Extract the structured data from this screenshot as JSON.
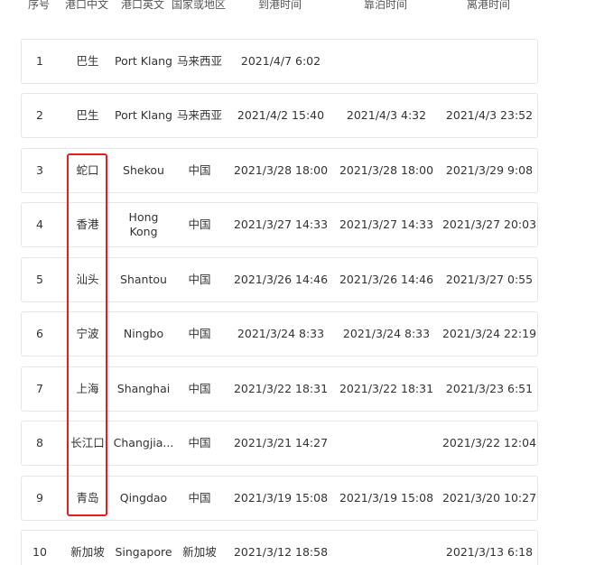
{
  "table": {
    "headers": [
      "序号",
      "港口中文",
      "港口英文",
      "国家或地区",
      "到港时间",
      "靠泊时间",
      "离港时间"
    ],
    "rows": [
      {
        "idx": "1",
        "port_cn": "巴生",
        "port_en": "Port Klang",
        "country": "马来西亚",
        "arrival": "2021/4/7 6:02",
        "berth": "",
        "departure": ""
      },
      {
        "idx": "2",
        "port_cn": "巴生",
        "port_en": "Port Klang",
        "country": "马来西亚",
        "arrival": "2021/4/2 15:40",
        "berth": "2021/4/3 4:32",
        "departure": "2021/4/3 23:52"
      },
      {
        "idx": "3",
        "port_cn": "蛇口",
        "port_en": "Shekou",
        "country": "中国",
        "arrival": "2021/3/28 18:00",
        "berth": "2021/3/28 18:00",
        "departure": "2021/3/29 9:08"
      },
      {
        "idx": "4",
        "port_cn": "香港",
        "port_en": "Hong Kong",
        "country": "中国",
        "arrival": "2021/3/27 14:33",
        "berth": "2021/3/27 14:33",
        "departure": "2021/3/27 20:03"
      },
      {
        "idx": "5",
        "port_cn": "汕头",
        "port_en": "Shantou",
        "country": "中国",
        "arrival": "2021/3/26 14:46",
        "berth": "2021/3/26 14:46",
        "departure": "2021/3/27 0:55"
      },
      {
        "idx": "6",
        "port_cn": "宁波",
        "port_en": "Ningbo",
        "country": "中国",
        "arrival": "2021/3/24 8:33",
        "berth": "2021/3/24 8:33",
        "departure": "2021/3/24 22:19"
      },
      {
        "idx": "7",
        "port_cn": "上海",
        "port_en": "Shanghai",
        "country": "中国",
        "arrival": "2021/3/22 18:31",
        "berth": "2021/3/22 18:31",
        "departure": "2021/3/23 6:51"
      },
      {
        "idx": "8",
        "port_cn": "长江口",
        "port_en": "Changjia...",
        "country": "中国",
        "arrival": "2021/3/21 14:27",
        "berth": "",
        "departure": "2021/3/22 12:04"
      },
      {
        "idx": "9",
        "port_cn": "青岛",
        "port_en": "Qingdao",
        "country": "中国",
        "arrival": "2021/3/19 15:08",
        "berth": "2021/3/19 15:08",
        "departure": "2021/3/20 10:27"
      },
      {
        "idx": "10",
        "port_cn": "新加坡",
        "port_en": "Singapore",
        "country": "新加坡",
        "arrival": "2021/3/12 18:58",
        "berth": "",
        "departure": "2021/3/13 6:18"
      }
    ]
  },
  "colors": {
    "highlight": "#e02020",
    "row_border": "#e6e6e6"
  }
}
